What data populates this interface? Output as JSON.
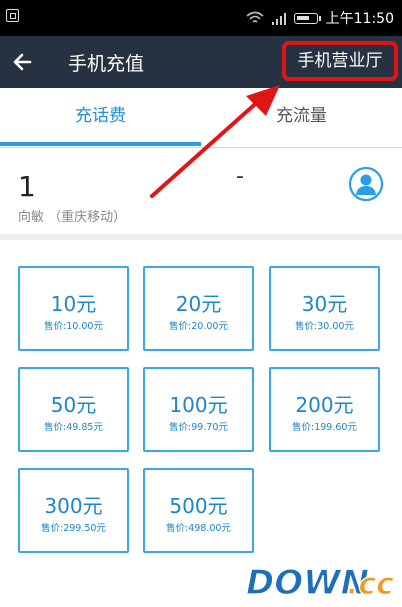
{
  "status_bar": {
    "time": "上午11:50",
    "icons": [
      "screenshot-icon",
      "wifi-icon",
      "signal-icon",
      "battery-icon"
    ]
  },
  "header": {
    "back_icon": "back-arrow-icon",
    "title": "手机充值",
    "right_link": "手机营业厅"
  },
  "tabs": [
    {
      "label": "充话费",
      "active": true
    },
    {
      "label": "充流量",
      "active": false
    }
  ],
  "phone": {
    "number": "1",
    "dash": "-",
    "owner": "向敏  （重庆移动）",
    "contact_icon": "contact-icon"
  },
  "recharge_options": [
    {
      "amount": "10元",
      "price": "售价:10.00元"
    },
    {
      "amount": "20元",
      "price": "售价:20.00元"
    },
    {
      "amount": "30元",
      "price": "售价:30.00元"
    },
    {
      "amount": "50元",
      "price": "售价:49.85元"
    },
    {
      "amount": "100元",
      "price": "售价:99.70元"
    },
    {
      "amount": "200元",
      "price": "售价:199.60元"
    },
    {
      "amount": "300元",
      "price": "售价:299.50元"
    },
    {
      "amount": "500元",
      "price": "售价:498.00元"
    }
  ],
  "colors": {
    "header_bg": "#263241",
    "accent": "#2b9fe6",
    "highlight_red": "#e01616"
  },
  "watermark": {
    "part1": "DOWN",
    "part2": ".cc"
  }
}
